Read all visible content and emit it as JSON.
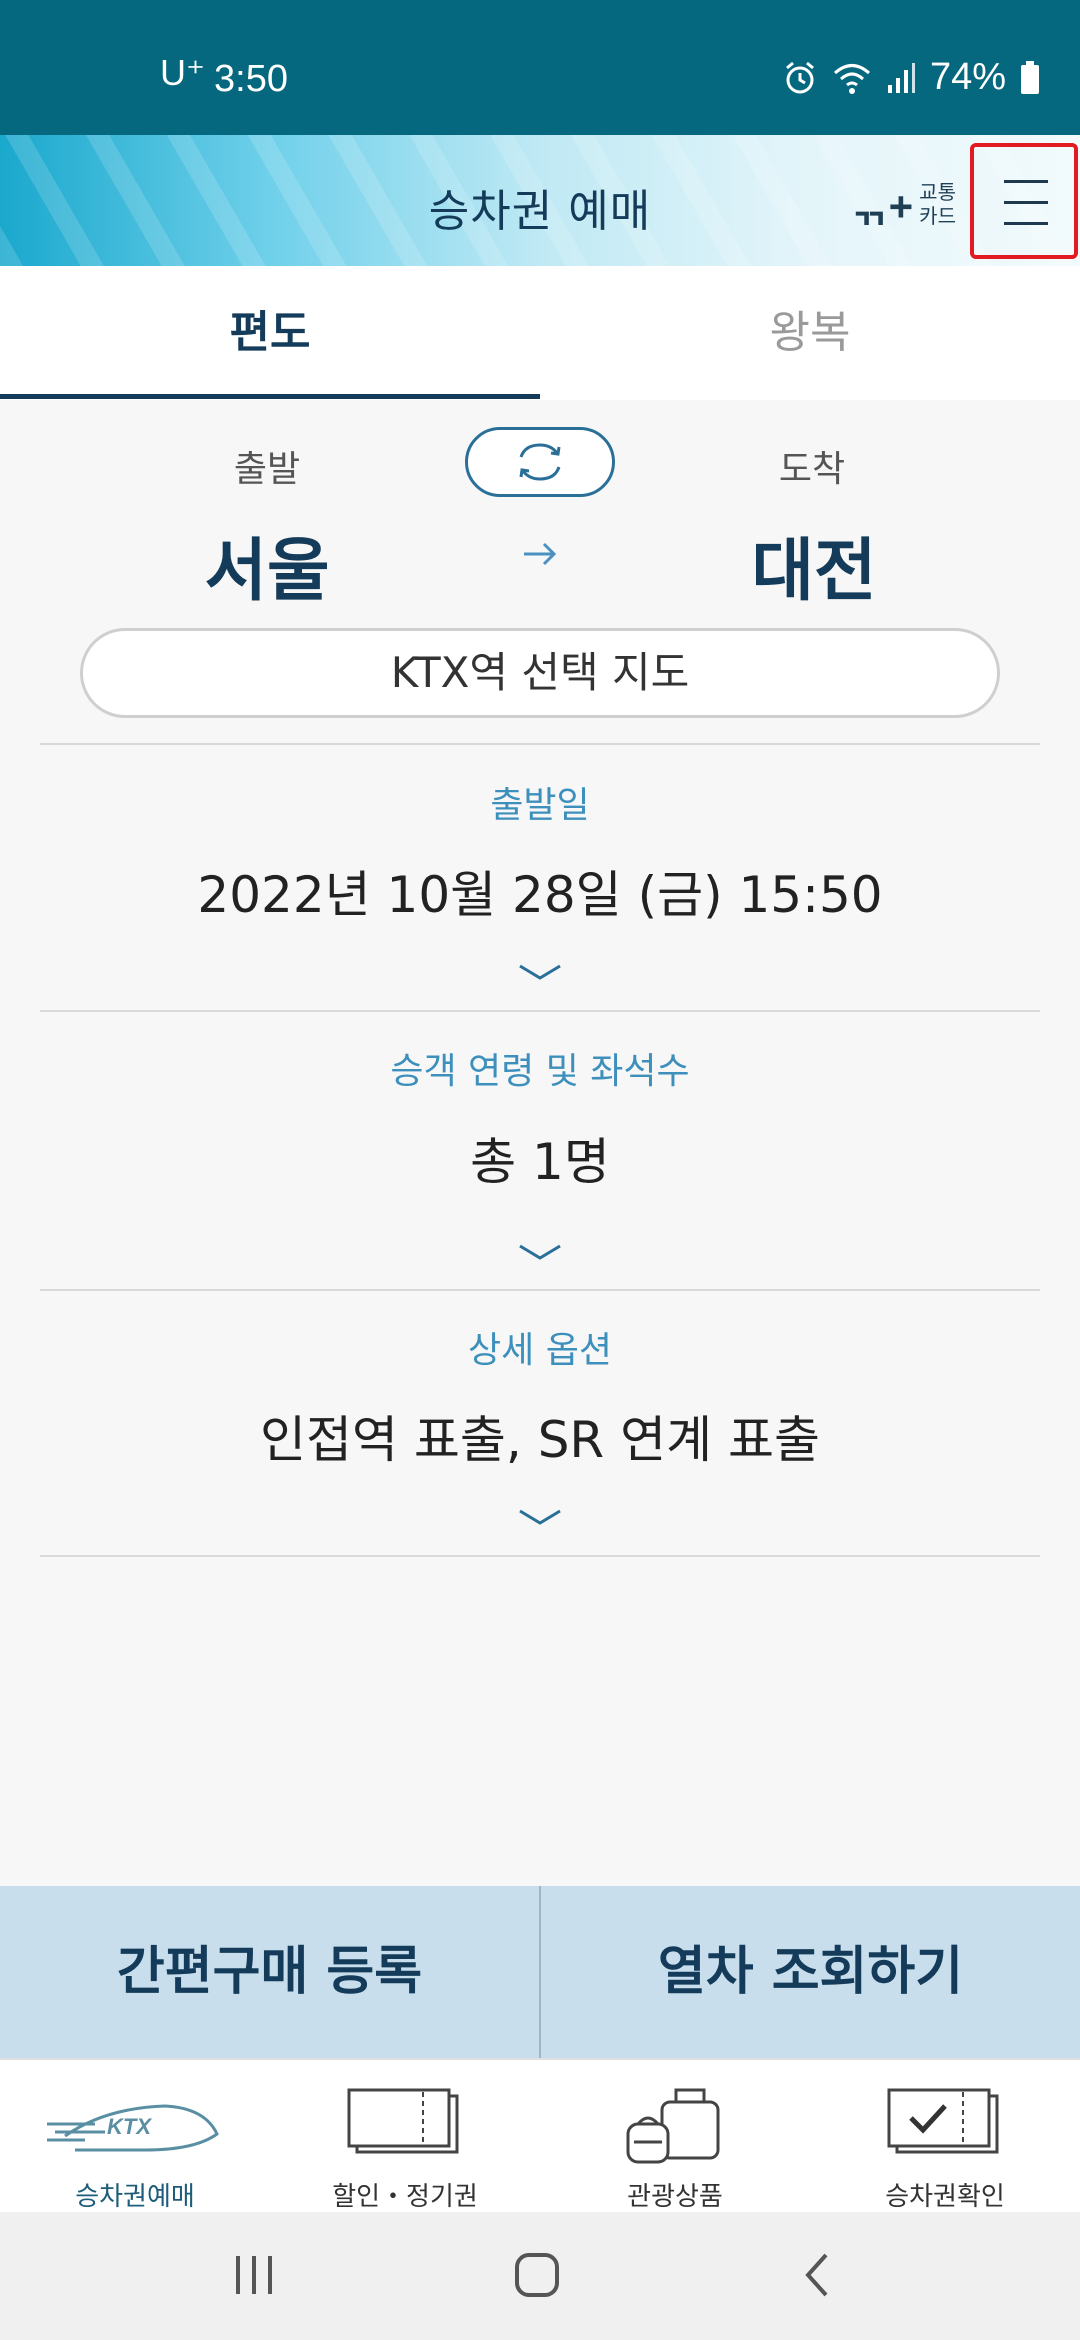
{
  "status_bar": {
    "carrier": "U⁺",
    "time": "3:50",
    "battery": "74%"
  },
  "header": {
    "title": "승차권 예매",
    "card_logo_line1": "교통",
    "card_logo_line2": "카드",
    "card_logo_mark": "ᆩ+"
  },
  "tabs": [
    {
      "label": "편도",
      "active": true
    },
    {
      "label": "왕복",
      "active": false
    }
  ],
  "route": {
    "departure_label": "출발",
    "departure_station": "서울",
    "arrival_label": "도착",
    "arrival_station": "대전",
    "map_button": "KTX역 선택 지도"
  },
  "sections": {
    "date": {
      "label": "출발일",
      "value": "2022년 10월 28일 (금) 15:50"
    },
    "passengers": {
      "label": "승객 연령 및 좌석수",
      "value": "총 1명"
    },
    "options": {
      "label": "상세 옵션",
      "value": "인접역 표출, SR 연계 표출"
    }
  },
  "actions": {
    "quick_purchase": "간편구매 등록",
    "search_trains": "열차 조회하기"
  },
  "bottom_nav": [
    {
      "label": "승차권예매",
      "icon": "ktx-train-icon"
    },
    {
      "label": "할인・정기권",
      "icon": "ticket-icon"
    },
    {
      "label": "관광상품",
      "icon": "luggage-icon"
    },
    {
      "label": "승차권확인",
      "icon": "ticket-check-icon"
    }
  ],
  "colors": {
    "brand_dark": "#143c5a",
    "accent_blue": "#3d8fbc",
    "status_bar": "#06687e",
    "highlight_box": "#e21b23"
  }
}
